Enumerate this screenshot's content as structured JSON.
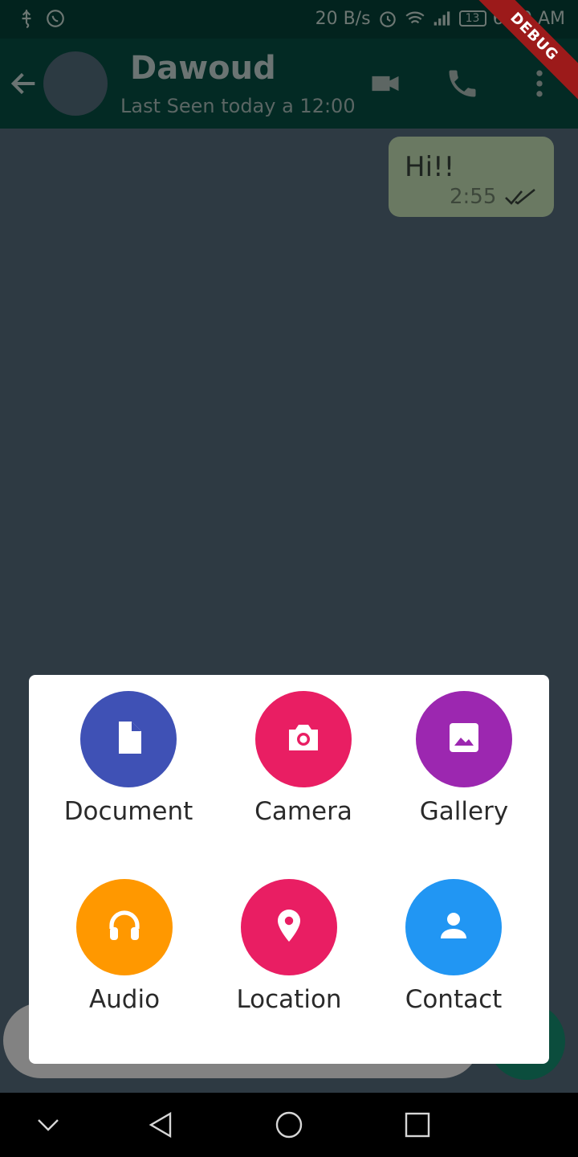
{
  "status": {
    "speed": "20 B/s",
    "battery": "13",
    "time": "6:30 AM",
    "debug": "DEBUG"
  },
  "chat": {
    "name": "Dawoud",
    "last_seen": "Last Seen today a 12:00"
  },
  "messages": [
    {
      "text": "Hi!!",
      "time": "2:55"
    }
  ],
  "attach": {
    "document": "Document",
    "camera": "Camera",
    "gallery": "Gallery",
    "audio": "Audio",
    "location": "Location",
    "contact": "Contact"
  },
  "colors": {
    "document": "#3f51b5",
    "camera": "#e91e63",
    "gallery": "#9c27b0",
    "audio": "#ff9800",
    "location": "#e91e63",
    "contact": "#2196f3"
  }
}
